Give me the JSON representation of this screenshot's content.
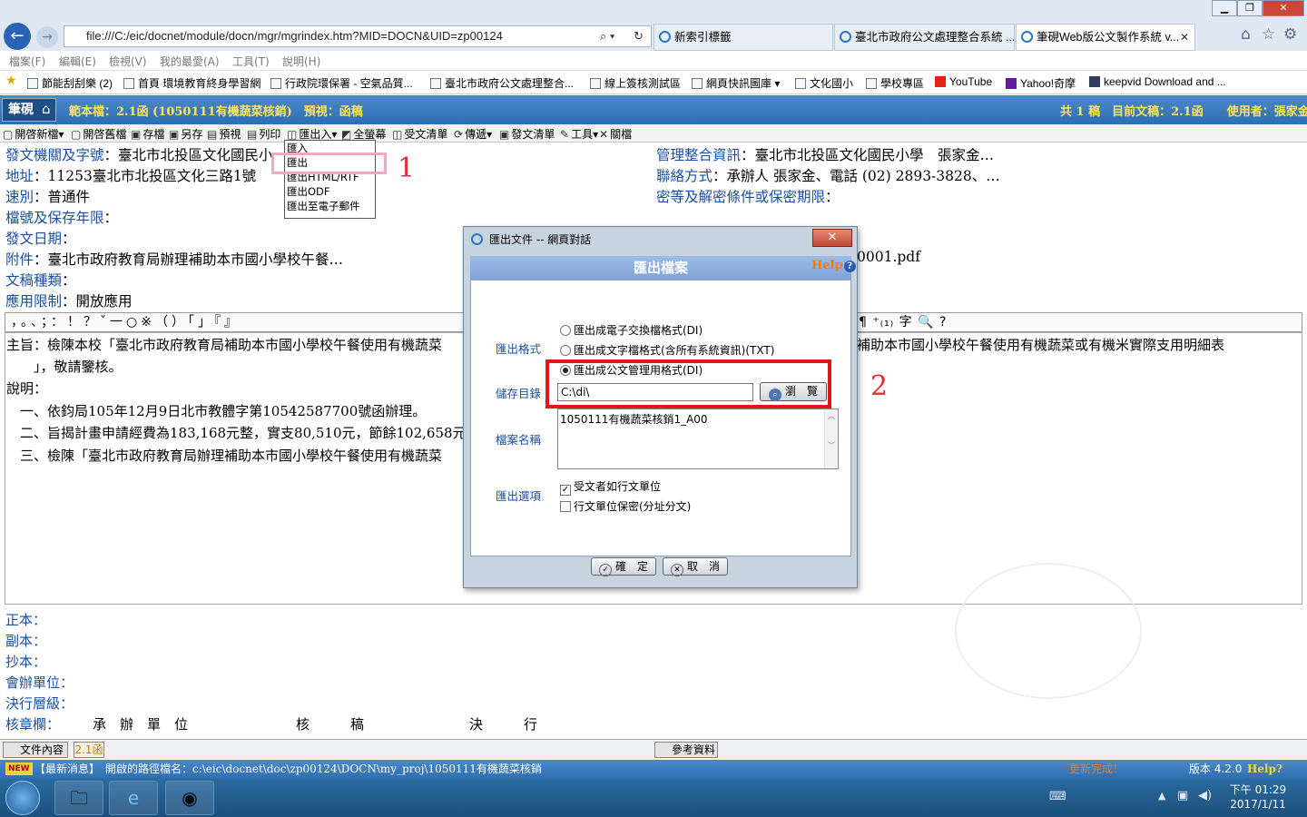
{
  "browser": {
    "address": "file:///C:/eic/docnet/module/docn/mgr/mgrindex.htm?MID=DOCN&UID=zp00124",
    "tabs": [
      {
        "label": "新索引標籤"
      },
      {
        "label": "臺北市政府公文處理整合系統 ..."
      },
      {
        "label": "筆硯Web版公文製作系統 v..."
      }
    ],
    "menu": [
      "檔案(F)",
      "編輯(E)",
      "檢視(V)",
      "我的最愛(A)",
      "工具(T)",
      "說明(H)"
    ],
    "favorites": [
      "節能刮刮樂 (2)",
      "首頁 環境教育終身學習網",
      "行政院環保署 - 空氣品質...",
      "臺北市政府公文處理整合...",
      "線上簽核測試區",
      "網頁快訊圖庫 ▾",
      "文化國小",
      "學校專區",
      "YouTube",
      "Yahoo!奇摩",
      "keepvid Download and ..."
    ]
  },
  "app": {
    "logo": "筆硯",
    "header_left": "範本檔：2.1函 (1050111有機蔬菜核銷)　預視：函稿",
    "header_right": "共 1 稿　目前文稿：2.1函　　使用者：張家金",
    "toolbar": [
      "開啓新檔▾",
      "開啓舊檔",
      "存檔",
      "另存",
      "預視",
      "列印",
      "匯出入▾",
      "全螢幕",
      "受文清單",
      "傳遞▾",
      "發文清單",
      "工具▾",
      "關檔"
    ]
  },
  "dropdown": [
    "匯入",
    "匯出",
    "匯出HTML/RTF",
    "匯出ODF",
    "匯出至電子郵件"
  ],
  "annotations": {
    "mark1": "1",
    "mark2": "2"
  },
  "doc": {
    "fields_left": [
      {
        "label": "發文機關及字號",
        "value": "：臺北市北投區文化國民小"
      },
      {
        "label": "地址",
        "value": "：11253臺北市北投區文化三路1號"
      },
      {
        "label": "速別",
        "value": "：普通件"
      },
      {
        "label": "檔號及保存年限",
        "value": "："
      },
      {
        "label": "發文日期",
        "value": "："
      },
      {
        "label": "附件",
        "value": "：臺北市政府教育局辦理補助本市國小學校午餐…"
      },
      {
        "label": "文稿種類",
        "value": "："
      },
      {
        "label": "應用限制",
        "value": "：開放應用"
      }
    ],
    "fields_right": [
      {
        "label": "管理整合資訊",
        "value": "：臺北市北投區文化國民小學　張家金…"
      },
      {
        "label": "聯絡方式",
        "value": "：承辦人 張家金、電話 (02) 2893-3828、…"
      },
      {
        "label": "密等及解密條件或保密期限",
        "value": "："
      }
    ],
    "attachment_suffix": "0001.pdf",
    "punct": "，。、；：！？ˇ一○※（）「」『』",
    "punct_right": "¶ ⁺₍₁₎ 字 🔍 ?",
    "body_lines": [
      "主旨：檢陳本校「臺北市政府教育局補助本市國小學校午餐使用有機蔬菜",
      "　　」，敬請鑒核。",
      "說明：",
      "　一、依鈞局105年12月9日北市教體字第10542587700號函辦理。",
      "　二、旨揭計畫申請經費為183,168元整，實支80,510元，節餘102,658元",
      "　三、檢陳「臺北市政府教育局辦理補助本市國小學校午餐使用有機蔬菜"
    ],
    "body_right": "補助本市國小學校午餐使用有機蔬菜或有機米實際支用明細表",
    "bottom_fields": [
      "正本：",
      "副本：",
      "抄本：",
      "會辦單位：",
      "決行層級：",
      "核章欄："
    ],
    "sign_cols": [
      "承　辦　單　位",
      "核　　　稿",
      "決　　　行"
    ]
  },
  "dialog": {
    "title": "匯出文件 -- 網頁對話",
    "close": "✕",
    "heading": "匯出檔案",
    "help": "Help",
    "format_label": "匯出格式",
    "formats": [
      "匯出成電子交換檔格式(DI)",
      "匯出成文字檔格式(含所有系統資訊)(TXT)",
      "匯出成公文管理用格式(DI)"
    ],
    "dir_label": "儲存目錄",
    "dir_value": "C:\\di\\",
    "browse": "瀏　覽",
    "fname_label": "檔案名稱",
    "fname_value": "1050111有機蔬菜核銷1_A00",
    "opts_label": "匯出選項",
    "options": [
      {
        "label": "受文者如行文單位",
        "checked": true
      },
      {
        "label": "行文單位保密(分址分文)",
        "checked": false
      }
    ],
    "ok": "確　定",
    "cancel": "取　消"
  },
  "bottombar": {
    "tab1": "文件內容",
    "tab2": "2.1函",
    "ref": "參考資料",
    "news_tag": "NEW",
    "news": "【最新消息】　開啟的路徑檔名：c:\\eic\\docnet\\doc\\zp00124\\DOCN\\my_proj\\1050111有機蔬菜核銷",
    "update": "更新完成！",
    "version": "版本 4.2.0",
    "help": "Help?"
  },
  "taskbar": {
    "time": "下午 01:29",
    "date": "2017/1/11"
  },
  "colors": {
    "accent": "#2f6eb0",
    "label_blue": "#1a4fa0",
    "annotation_red": "#e01818",
    "annotation_pink": "#f4a7c2"
  }
}
